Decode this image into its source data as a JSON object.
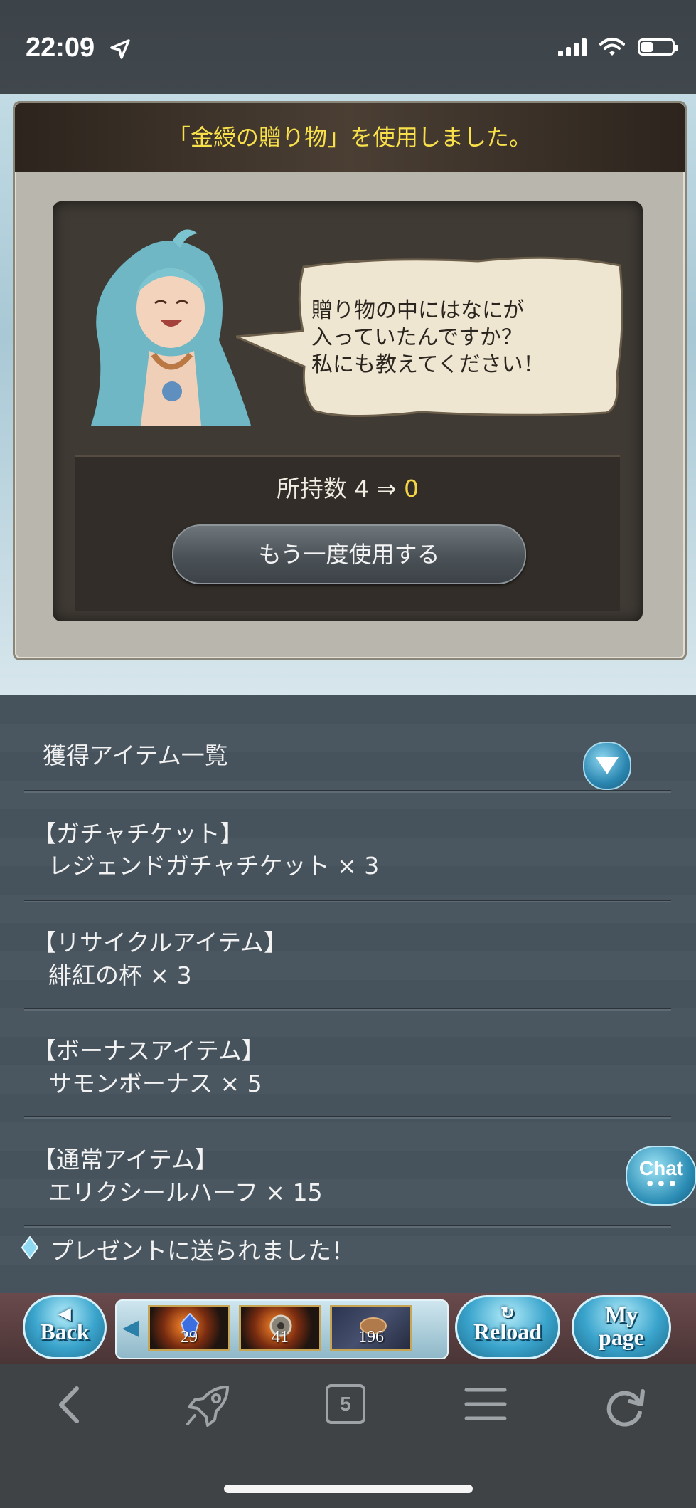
{
  "status_bar": {
    "time": "22:09"
  },
  "dialog": {
    "title": "「金綬の贈り物」を使用しました。",
    "speech_lines": [
      "贈り物の中にはなにが",
      "入っていたんですか？",
      "私にも教えてください！"
    ],
    "count_label": "所持数",
    "count_before": "4",
    "count_arrow": "⇒",
    "count_after": "0",
    "reuse_button": "もう一度使用する"
  },
  "item_list": {
    "header": "獲得アイテム一覧",
    "categories": [
      {
        "label": "【ガチャチケット】",
        "item": "レジェンドガチャチケット × 3"
      },
      {
        "label": "【リサイクルアイテム】",
        "item": "緋紅の杯 × 3"
      },
      {
        "label": "【ボーナスアイテム】",
        "item": "サモンボーナス × 5"
      },
      {
        "label": "【通常アイテム】",
        "item": "エリクシールハーフ × 15"
      }
    ],
    "notice": "プレゼントに送られました！"
  },
  "chat_button": "Chat",
  "game_nav": {
    "back": "Back",
    "reload": "Reload",
    "mypage_line1": "My",
    "mypage_line2": "page",
    "shortcuts": [
      {
        "count": "29"
      },
      {
        "count": "41"
      },
      {
        "count": "196"
      }
    ]
  },
  "browser_toolbar": {
    "tab_count": "5"
  },
  "colors": {
    "title_yellow": "#f7e04a",
    "count_after": "#f4d545",
    "accent_blue": "#3aa4cc"
  }
}
